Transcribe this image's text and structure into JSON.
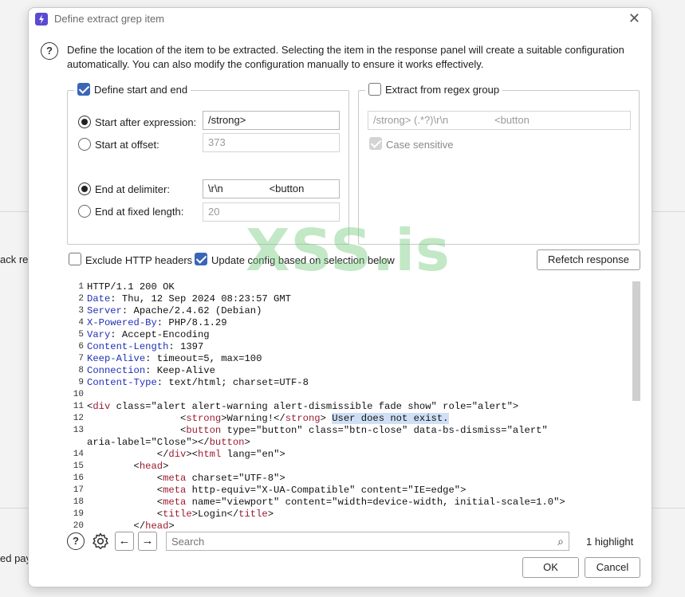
{
  "background": {
    "left_text_1": "ack re",
    "left_text_2": "ed pay"
  },
  "dialog": {
    "title": "Define extract grep item",
    "description": "Define the location of the item to be extracted. Selecting the item in the response panel will create a suitable configuration automatically. You can also modify the configuration manually to ensure it works effectively."
  },
  "start_end": {
    "legend": "Define start and end",
    "start_after_label": "Start after expression:",
    "start_after_value": "/strong>",
    "start_offset_label": "Start at offset:",
    "start_offset_value": "373",
    "end_delim_label": "End at delimiter:",
    "end_delim_value": "\\r\\n                <button",
    "end_fixed_label": "End at fixed length:",
    "end_fixed_value": "20"
  },
  "regex": {
    "legend": "Extract from regex group",
    "value": "/strong> (.*?)\\r\\n                <button",
    "case_label": "Case sensitive"
  },
  "options": {
    "exclude_headers": "Exclude HTTP headers",
    "update_config": "Update config based on selection below",
    "refetch": "Refetch response"
  },
  "code_lines": [
    {
      "n": "1",
      "t": "HTTP/1.1 200 OK"
    },
    {
      "n": "2",
      "t": "Date: Thu, 12 Sep 2024 08:23:57 GMT"
    },
    {
      "n": "3",
      "t": "Server: Apache/2.4.62 (Debian)"
    },
    {
      "n": "4",
      "t": "X-Powered-By: PHP/8.1.29"
    },
    {
      "n": "5",
      "t": "Vary: Accept-Encoding"
    },
    {
      "n": "6",
      "t": "Content-Length: 1397"
    },
    {
      "n": "7",
      "t": "Keep-Alive: timeout=5, max=100"
    },
    {
      "n": "8",
      "t": "Connection: Keep-Alive"
    },
    {
      "n": "9",
      "t": "Content-Type: text/html; charset=UTF-8"
    },
    {
      "n": "10",
      "t": ""
    },
    {
      "n": "11",
      "t": "<div class=\"alert alert-warning alert-dismissible fade show\" role=\"alert\">"
    },
    {
      "n": "12",
      "t": "                <strong>Warning!</strong> User does not exist."
    },
    {
      "n": "13",
      "t": "                <button type=\"button\" class=\"btn-close\" data-bs-dismiss=\"alert\""
    },
    {
      "n": "",
      "t": "aria-label=\"Close\"></button>"
    },
    {
      "n": "14",
      "t": "            </div><html lang=\"en\">"
    },
    {
      "n": "15",
      "t": "        <head>"
    },
    {
      "n": "16",
      "t": "            <meta charset=\"UTF-8\">"
    },
    {
      "n": "17",
      "t": "            <meta http-equiv=\"X-UA-Compatible\" content=\"IE=edge\">"
    },
    {
      "n": "18",
      "t": "            <meta name=\"viewport\" content=\"width=device-width, initial-scale=1.0\">"
    },
    {
      "n": "19",
      "t": "            <title>Login</title>"
    },
    {
      "n": "20",
      "t": "        </head>"
    }
  ],
  "highlight_text": "User does not exist.",
  "search": {
    "placeholder": "Search",
    "highlight_count": "1 highlight"
  },
  "buttons": {
    "ok": "OK",
    "cancel": "Cancel"
  },
  "watermark": "XSS.is",
  "colors": {
    "accent": "#3a66b8",
    "tag": "#9b1b30",
    "attr": "#2030b8",
    "highlight": "#cfe0f5"
  }
}
